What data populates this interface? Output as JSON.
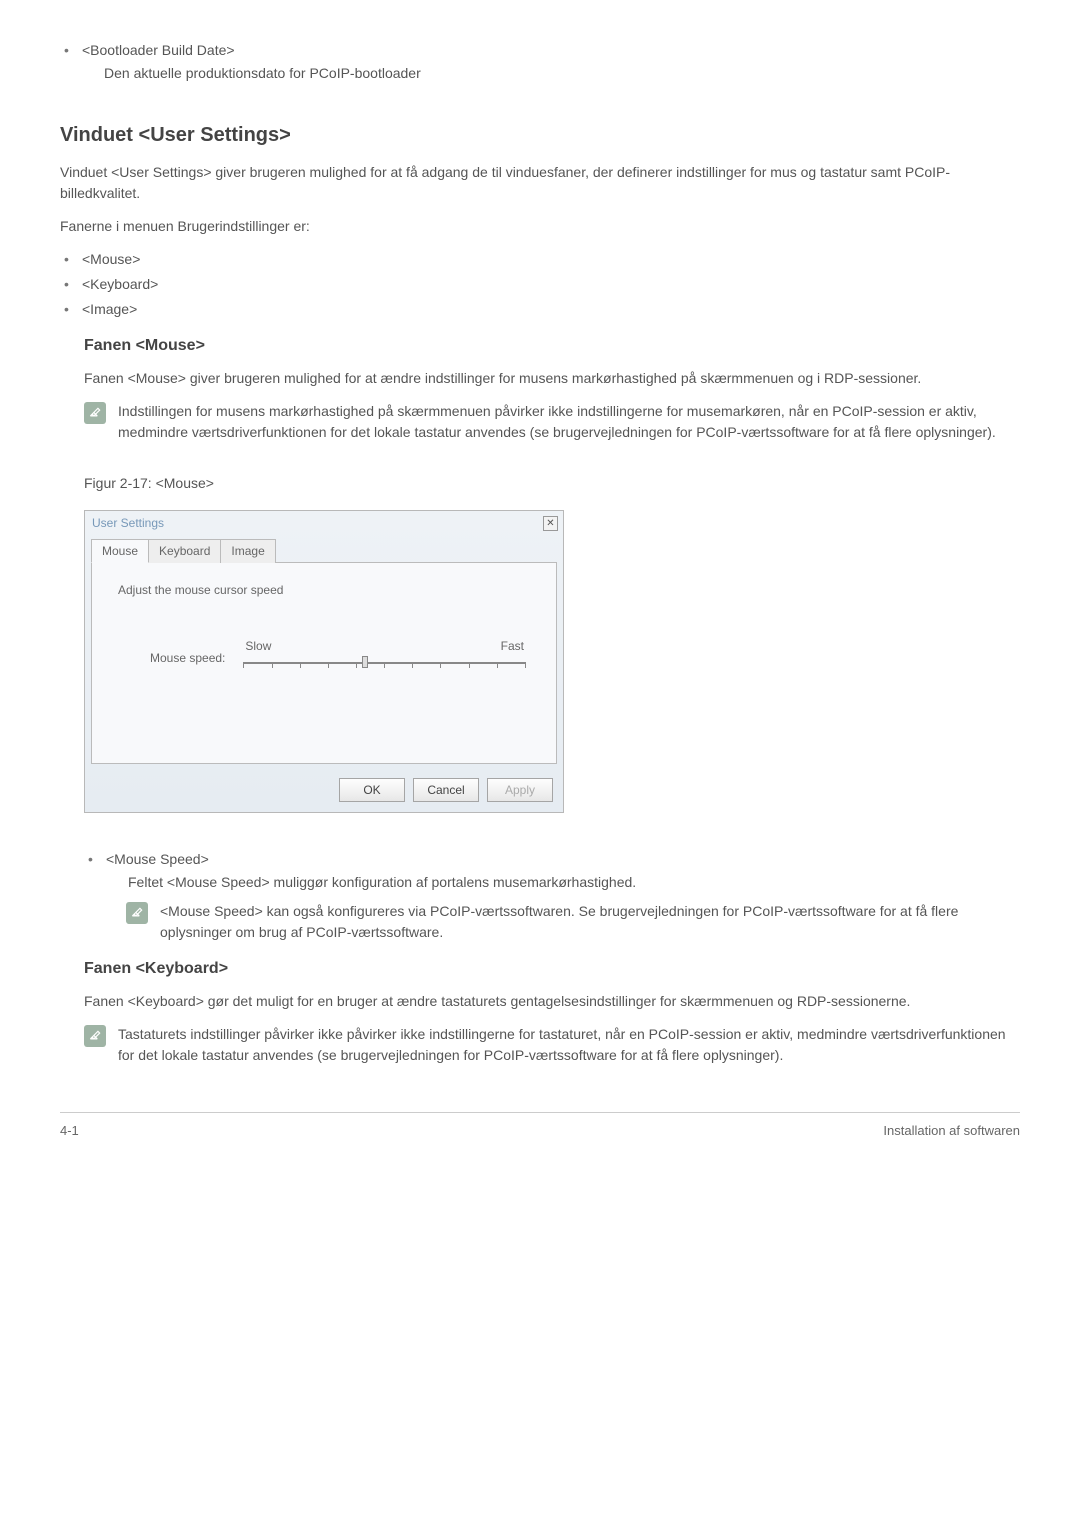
{
  "intro": {
    "bootloader_title": "<Bootloader Build Date>",
    "bootloader_desc": "Den aktuelle produktionsdato for PCoIP-bootloader"
  },
  "section1": {
    "heading": "Vinduet <User Settings>",
    "para1": "Vinduet <User Settings> giver brugeren mulighed for at få adgang de til vinduesfaner, der definerer indstillinger for mus og tastatur samt PCoIP-billedkvalitet.",
    "para2": "Fanerne i menuen Brugerindstillinger er:",
    "items": [
      "<Mouse>",
      "<Keyboard>",
      "<Image>"
    ]
  },
  "section_mouse": {
    "heading": "Fanen <Mouse>",
    "para1": "Fanen <Mouse> giver brugeren mulighed for at ændre indstillinger for musens markørhastighed på skærmmenuen og i RDP-sessioner.",
    "note1": "Indstillingen for musens markørhastighed på skærmmenuen påvirker ikke indstillingerne for musemarkøren, når en PCoIP-session er aktiv, medmindre værtsdriverfunktionen for det lokale tastatur anvendes (se brugervejledningen for PCoIP-værtssoftware for at få flere oplysninger).",
    "figure_caption": "Figur 2-17: <Mouse>"
  },
  "dialog": {
    "title": "User Settings",
    "tabs": [
      "Mouse",
      "Keyboard",
      "Image"
    ],
    "panel_text": "Adjust the mouse cursor speed",
    "slider_name": "Mouse speed:",
    "slow": "Slow",
    "fast": "Fast",
    "ok": "OK",
    "cancel": "Cancel",
    "apply": "Apply"
  },
  "section_mouse_speed": {
    "title": "<Mouse Speed>",
    "desc": "Feltet <Mouse Speed> muliggør konfiguration af portalens musemarkørhastighed.",
    "note": "<Mouse Speed> kan også konfigureres via PCoIP-værtssoftwaren. Se brugervejledningen for PCoIP-værtssoftware for at få flere oplysninger om brug af PCoIP-værtssoftware."
  },
  "section_keyboard": {
    "heading": "Fanen <Keyboard>",
    "para1": "Fanen <Keyboard> gør det muligt for en bruger at ændre tastaturets gentagelsesindstillinger for skærmmenuen og RDP-sessionerne.",
    "note": "Tastaturets indstillinger påvirker ikke påvirker ikke indstillingerne for tastaturet, når en PCoIP-session er aktiv, medmindre værtsdriverfunktionen for det lokale tastatur anvendes (se brugervejledningen for PCoIP-værtssoftware for at få flere oplysninger)."
  },
  "footer": {
    "left": "4-1",
    "right": "Installation af softwaren"
  }
}
